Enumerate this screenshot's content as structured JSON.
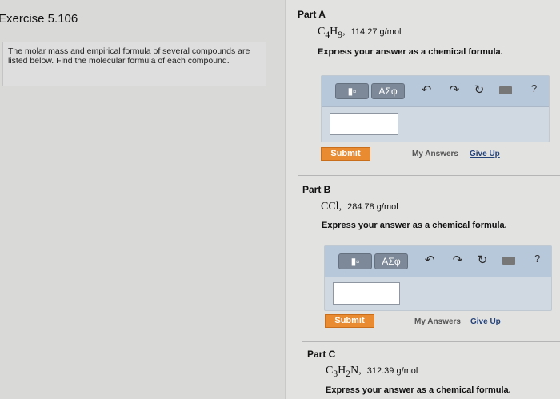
{
  "exercise": {
    "title": "Exercise 5.106",
    "instructions": "The molar mass and empirical formula of several compounds are listed below. Find the molecular formula of each compound."
  },
  "toolbar": {
    "template_icon": "template-icon",
    "greek_label": "ΑΣφ",
    "undo_icon": "undo-icon",
    "redo_icon": "redo-icon",
    "reset_icon": "reset-icon",
    "keyboard_icon": "keyboard-icon",
    "help_label": "?"
  },
  "parts": [
    {
      "label": "Part A",
      "formula_parts": [
        "C",
        "4",
        "H",
        "9"
      ],
      "molar_mass": "114.27 g/mol",
      "prompt": "Express your answer as a chemical formula.",
      "submit_label": "Submit",
      "my_answers_label": "My Answers",
      "give_up_label": "Give Up"
    },
    {
      "label": "Part B",
      "formula_parts": [
        "CCl"
      ],
      "molar_mass": "284.78 g/mol",
      "prompt": "Express your answer as a chemical formula.",
      "submit_label": "Submit",
      "my_answers_label": "My Answers",
      "give_up_label": "Give Up"
    },
    {
      "label": "Part C",
      "formula_parts": [
        "C",
        "3",
        "H",
        "2",
        "N"
      ],
      "molar_mass": "312.39 g/mol",
      "prompt": "Express your answer as a chemical formula."
    }
  ],
  "colors": {
    "submit": "#e98b31",
    "toolbar": "#b8c8db",
    "link": "#24427a"
  }
}
